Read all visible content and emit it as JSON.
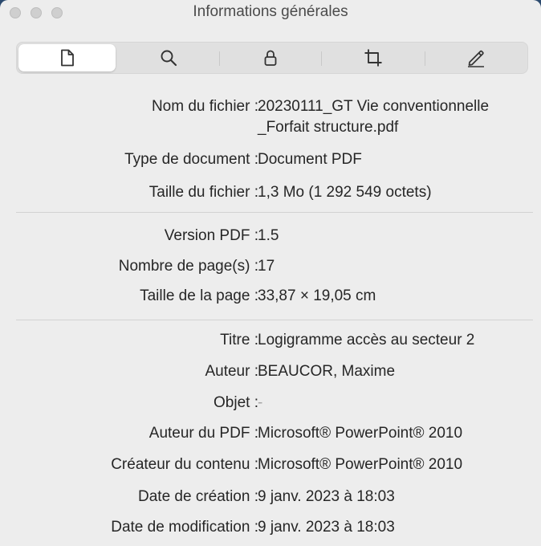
{
  "window": {
    "title": "Informations générales"
  },
  "tabs": [
    {
      "name": "general",
      "icon": "document-icon"
    },
    {
      "name": "search",
      "icon": "magnifier-icon"
    },
    {
      "name": "security",
      "icon": "lock-icon"
    },
    {
      "name": "crop",
      "icon": "crop-icon"
    },
    {
      "name": "annotate",
      "icon": "pencil-icon"
    }
  ],
  "file": {
    "name_label": "Nom du fichier :",
    "name_line1": "20230111_GT Vie conventionnelle",
    "name_line2": "_Forfait structure.pdf",
    "type_label": "Type de document :",
    "type_value": "Document PDF",
    "size_label": "Taille du fichier :",
    "size_value": "1,3 Mo (1 292 549 octets)"
  },
  "pdf": {
    "version_label": "Version PDF :",
    "version_value": "1.5",
    "pages_label": "Nombre de page(s) :",
    "pages_value": "17",
    "pagesize_label": "Taille de la page :",
    "pagesize_value": "33,87 × 19,05 cm"
  },
  "meta": {
    "title_label": "Titre :",
    "title_value": "Logigramme accès au secteur 2",
    "author_label": "Auteur :",
    "author_value": "BEAUCOR, Maxime",
    "subject_label": "Objet :",
    "subject_value": "-",
    "pdf_author_label": "Auteur du PDF :",
    "pdf_author_value": "Microsoft® PowerPoint® 2010",
    "creator_label": "Créateur du contenu :",
    "creator_value": "Microsoft® PowerPoint® 2010",
    "created_label": "Date de création :",
    "created_value": "9 janv. 2023 à 18:03",
    "modified_label": "Date de modification :",
    "modified_value": "9 janv. 2023 à 18:03"
  }
}
